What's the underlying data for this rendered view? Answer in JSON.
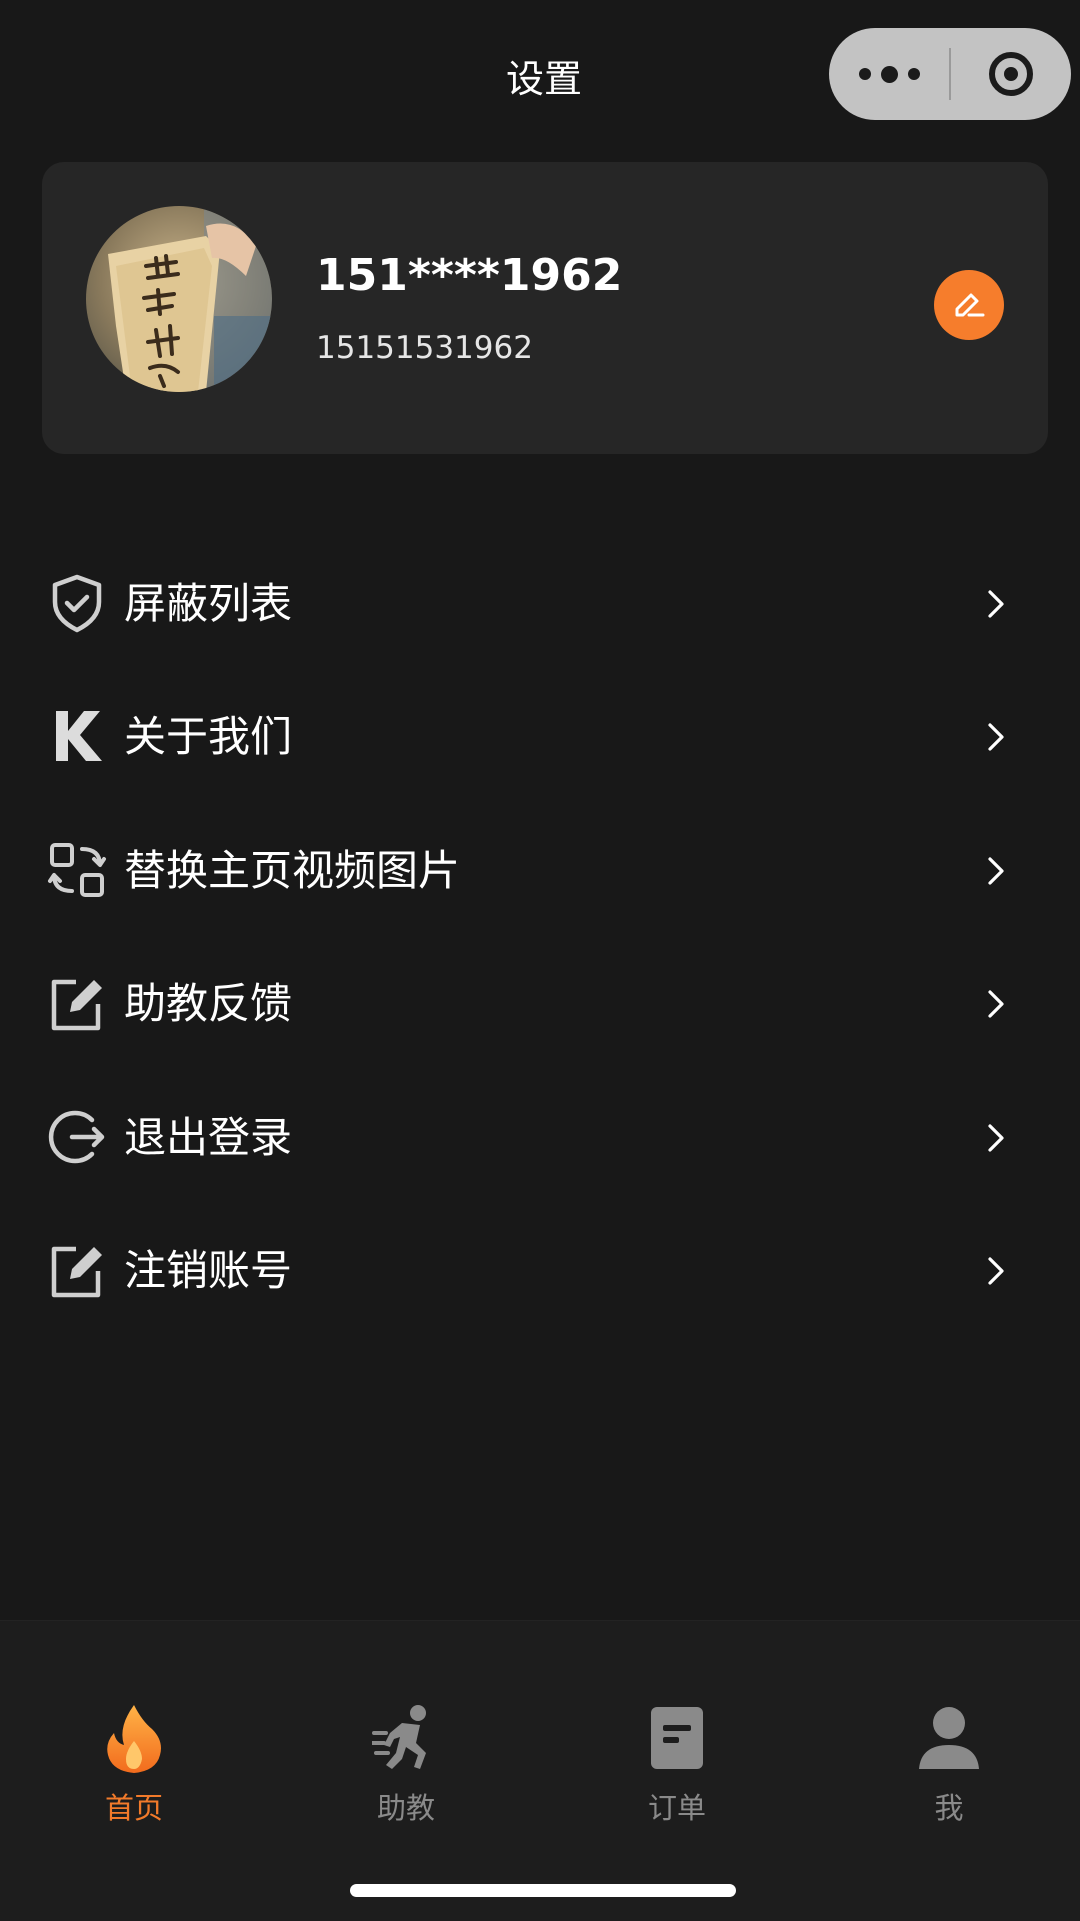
{
  "header": {
    "title": "设置",
    "more_icon": "more-dots-icon",
    "close_icon": "target-close-icon"
  },
  "profile": {
    "name": "151****1962",
    "phone": "15151531962",
    "avatar_icon": "avatar-photo",
    "edit_icon": "edit-pencil-icon",
    "accent_color": "#f67d2c"
  },
  "menu": {
    "items": [
      {
        "label": "屏蔽列表",
        "icon": "shield-check-icon"
      },
      {
        "label": "关于我们",
        "icon": "k-logo-icon"
      },
      {
        "label": "替换主页视频图片",
        "icon": "swap-icon"
      },
      {
        "label": "助教反馈",
        "icon": "edit-square-icon"
      },
      {
        "label": "退出登录",
        "icon": "logout-icon"
      },
      {
        "label": "注销账号",
        "icon": "edit-square-icon"
      }
    ]
  },
  "tabbar": {
    "active_color": "#f27a2a",
    "inactive_color": "#8a8a8a",
    "tabs": [
      {
        "label": "首页",
        "icon": "flame-icon",
        "active": true
      },
      {
        "label": "助教",
        "icon": "runner-icon",
        "active": false
      },
      {
        "label": "订单",
        "icon": "document-icon",
        "active": false
      },
      {
        "label": "我",
        "icon": "user-icon",
        "active": false
      }
    ]
  }
}
